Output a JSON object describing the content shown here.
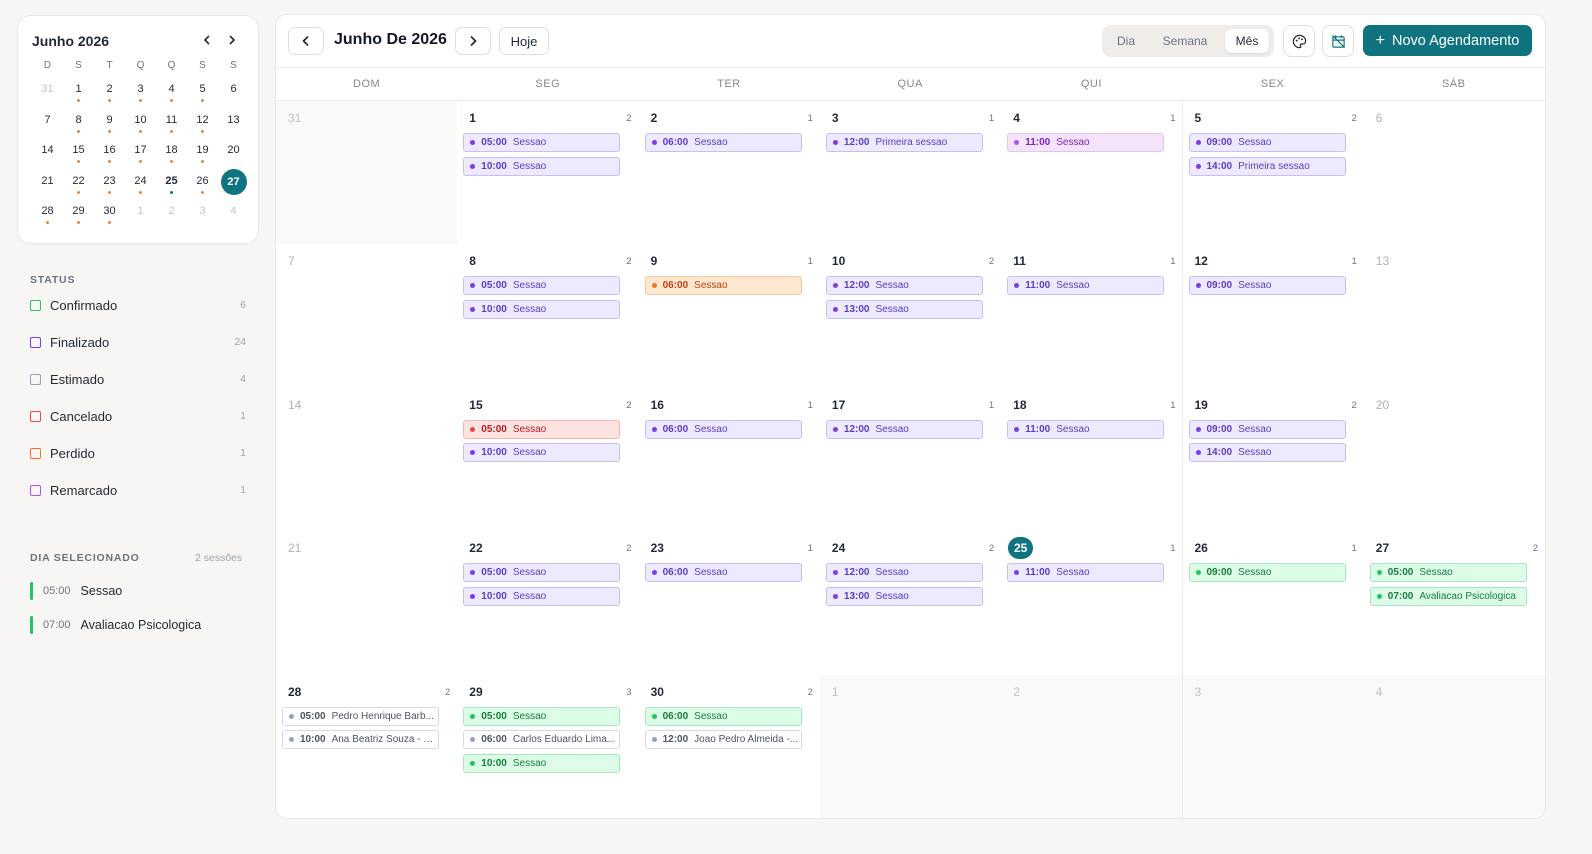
{
  "mini_calendar": {
    "title": "Junho 2026",
    "weekdays": [
      "D",
      "S",
      "T",
      "Q",
      "Q",
      "S",
      "S"
    ],
    "days": [
      {
        "d": "31",
        "muted": true,
        "dot": false
      },
      {
        "d": "1",
        "dot": true
      },
      {
        "d": "2",
        "dot": true
      },
      {
        "d": "3",
        "dot": true
      },
      {
        "d": "4",
        "dot": true
      },
      {
        "d": "5",
        "dot": true
      },
      {
        "d": "6",
        "dot": false
      },
      {
        "d": "7",
        "dot": false
      },
      {
        "d": "8",
        "dot": true
      },
      {
        "d": "9",
        "dot": true
      },
      {
        "d": "10",
        "dot": true
      },
      {
        "d": "11",
        "dot": true
      },
      {
        "d": "12",
        "dot": true
      },
      {
        "d": "13",
        "dot": false
      },
      {
        "d": "14",
        "dot": false
      },
      {
        "d": "15",
        "dot": true
      },
      {
        "d": "16",
        "dot": true
      },
      {
        "d": "17",
        "dot": true
      },
      {
        "d": "18",
        "dot": true
      },
      {
        "d": "19",
        "dot": true
      },
      {
        "d": "20",
        "dot": false
      },
      {
        "d": "21",
        "dot": false
      },
      {
        "d": "22",
        "dot": true
      },
      {
        "d": "23",
        "dot": true
      },
      {
        "d": "24",
        "dot": true
      },
      {
        "d": "25",
        "dot": true,
        "today": true
      },
      {
        "d": "26",
        "dot": true
      },
      {
        "d": "27",
        "dot": false,
        "selected": true
      },
      {
        "d": "28",
        "dot": true
      },
      {
        "d": "29",
        "dot": true
      },
      {
        "d": "30",
        "dot": true
      },
      {
        "d": "1",
        "muted": true
      },
      {
        "d": "2",
        "muted": true
      },
      {
        "d": "3",
        "muted": true
      },
      {
        "d": "4",
        "muted": true
      }
    ]
  },
  "status": {
    "label": "STATUS",
    "items": [
      {
        "name": "Confirmado",
        "count": "6",
        "color": "#22c55e"
      },
      {
        "name": "Finalizado",
        "count": "24",
        "color": "#7c3aed"
      },
      {
        "name": "Estimado",
        "count": "4",
        "color": "#94a3b8"
      },
      {
        "name": "Cancelado",
        "count": "1",
        "color": "#ef4444"
      },
      {
        "name": "Perdido",
        "count": "1",
        "color": "#f97316"
      },
      {
        "name": "Remarcado",
        "count": "1",
        "color": "#a855f7"
      }
    ]
  },
  "selected_day": {
    "label": "DIA SELECIONADO",
    "count": "2 sessões",
    "items": [
      {
        "time": "05:00",
        "title": "Sessao"
      },
      {
        "time": "07:00",
        "title": "Avaliacao Psicologica"
      }
    ]
  },
  "toolbar": {
    "month_title": "Junho De 2026",
    "today_label": "Hoje",
    "views": [
      "Dia",
      "Semana",
      "Mês"
    ],
    "active_view": "Mês",
    "new_label": "Novo Agendamento"
  },
  "weekdays": [
    "DOM",
    "SEG",
    "TER",
    "QUA",
    "QUI",
    "SEX",
    "SÁB"
  ],
  "weeks": [
    [
      {
        "d": "31",
        "other": true,
        "events": []
      },
      {
        "d": "1",
        "count": "2",
        "events": [
          {
            "t": "05:00",
            "n": "Sessao",
            "c": "purple"
          },
          {
            "t": "10:00",
            "n": "Sessao",
            "c": "purple"
          }
        ]
      },
      {
        "d": "2",
        "count": "1",
        "events": [
          {
            "t": "06:00",
            "n": "Sessao",
            "c": "purple"
          }
        ]
      },
      {
        "d": "3",
        "count": "1",
        "events": [
          {
            "t": "12:00",
            "n": "Primeira sessao",
            "c": "purple"
          }
        ]
      },
      {
        "d": "4",
        "count": "1",
        "events": [
          {
            "t": "11:00",
            "n": "Sessao",
            "c": "pink"
          }
        ]
      },
      {
        "d": "5",
        "count": "2",
        "events": [
          {
            "t": "09:00",
            "n": "Sessao",
            "c": "purple"
          },
          {
            "t": "14:00",
            "n": "Primeira sessao",
            "c": "purple"
          }
        ]
      },
      {
        "d": "6",
        "events": []
      }
    ],
    [
      {
        "d": "7",
        "events": []
      },
      {
        "d": "8",
        "count": "2",
        "events": [
          {
            "t": "05:00",
            "n": "Sessao",
            "c": "purple"
          },
          {
            "t": "10:00",
            "n": "Sessao",
            "c": "purple"
          }
        ]
      },
      {
        "d": "9",
        "count": "1",
        "events": [
          {
            "t": "06:00",
            "n": "Sessao",
            "c": "orange"
          }
        ]
      },
      {
        "d": "10",
        "count": "2",
        "events": [
          {
            "t": "12:00",
            "n": "Sessao",
            "c": "purple"
          },
          {
            "t": "13:00",
            "n": "Sessao",
            "c": "purple"
          }
        ]
      },
      {
        "d": "11",
        "count": "1",
        "events": [
          {
            "t": "11:00",
            "n": "Sessao",
            "c": "purple"
          }
        ]
      },
      {
        "d": "12",
        "count": "1",
        "events": [
          {
            "t": "09:00",
            "n": "Sessao",
            "c": "purple"
          }
        ]
      },
      {
        "d": "13",
        "events": []
      }
    ],
    [
      {
        "d": "14",
        "events": []
      },
      {
        "d": "15",
        "count": "2",
        "events": [
          {
            "t": "05:00",
            "n": "Sessao",
            "c": "red"
          },
          {
            "t": "10:00",
            "n": "Sessao",
            "c": "purple"
          }
        ]
      },
      {
        "d": "16",
        "count": "1",
        "events": [
          {
            "t": "06:00",
            "n": "Sessao",
            "c": "purple"
          }
        ]
      },
      {
        "d": "17",
        "count": "1",
        "events": [
          {
            "t": "12:00",
            "n": "Sessao",
            "c": "purple"
          }
        ]
      },
      {
        "d": "18",
        "count": "1",
        "events": [
          {
            "t": "11:00",
            "n": "Sessao",
            "c": "purple"
          }
        ]
      },
      {
        "d": "19",
        "count": "2",
        "events": [
          {
            "t": "09:00",
            "n": "Sessao",
            "c": "purple"
          },
          {
            "t": "14:00",
            "n": "Sessao",
            "c": "purple"
          }
        ]
      },
      {
        "d": "20",
        "events": []
      }
    ],
    [
      {
        "d": "21",
        "events": []
      },
      {
        "d": "22",
        "count": "2",
        "events": [
          {
            "t": "05:00",
            "n": "Sessao",
            "c": "purple"
          },
          {
            "t": "10:00",
            "n": "Sessao",
            "c": "purple"
          }
        ]
      },
      {
        "d": "23",
        "count": "1",
        "events": [
          {
            "t": "06:00",
            "n": "Sessao",
            "c": "purple"
          }
        ]
      },
      {
        "d": "24",
        "count": "2",
        "events": [
          {
            "t": "12:00",
            "n": "Sessao",
            "c": "purple"
          },
          {
            "t": "13:00",
            "n": "Sessao",
            "c": "purple"
          }
        ]
      },
      {
        "d": "25",
        "count": "1",
        "today": true,
        "events": [
          {
            "t": "11:00",
            "n": "Sessao",
            "c": "purple"
          }
        ]
      },
      {
        "d": "26",
        "count": "1",
        "events": [
          {
            "t": "09:00",
            "n": "Sessao",
            "c": "green"
          }
        ]
      },
      {
        "d": "27",
        "count": "2",
        "events": [
          {
            "t": "05:00",
            "n": "Sessao",
            "c": "green"
          },
          {
            "t": "07:00",
            "n": "Avaliacao Psicologica",
            "c": "green"
          }
        ]
      }
    ],
    [
      {
        "d": "28",
        "count": "2",
        "events": [
          {
            "t": "05:00",
            "n": "Pedro Henrique Barb...",
            "c": "gray"
          },
          {
            "t": "10:00",
            "n": "Ana Beatriz Souza - S...",
            "c": "gray"
          }
        ]
      },
      {
        "d": "29",
        "count": "3",
        "events": [
          {
            "t": "05:00",
            "n": "Sessao",
            "c": "green"
          },
          {
            "t": "06:00",
            "n": "Carlos Eduardo Lima...",
            "c": "gray"
          },
          {
            "t": "10:00",
            "n": "Sessao",
            "c": "green"
          }
        ]
      },
      {
        "d": "30",
        "count": "2",
        "events": [
          {
            "t": "06:00",
            "n": "Sessao",
            "c": "green"
          },
          {
            "t": "12:00",
            "n": "Joao Pedro Almeida -...",
            "c": "gray"
          }
        ]
      },
      {
        "d": "1",
        "other": true,
        "events": []
      },
      {
        "d": "2",
        "other": true,
        "events": []
      },
      {
        "d": "3",
        "other": true,
        "events": []
      },
      {
        "d": "4",
        "other": true,
        "events": []
      }
    ]
  ],
  "icons": {
    "prev": "chevron-left-icon",
    "next": "chevron-right-icon",
    "palette": "palette-icon",
    "calendar_off": "calendar-off-icon",
    "plus": "plus-icon"
  },
  "colors": {
    "accent": "#0f7480"
  }
}
